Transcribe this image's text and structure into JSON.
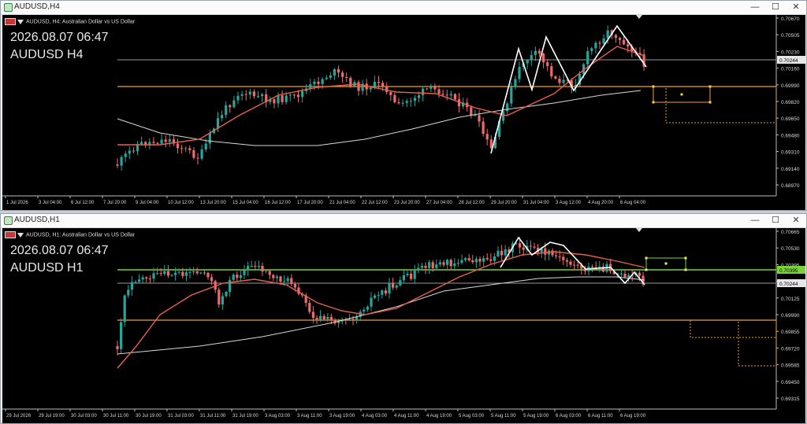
{
  "windows": [
    {
      "title": "AUDUSD,H4",
      "symbol_label": "AUDUSD, H4:  Australian Dollar vs US Dollar",
      "overlay_date": "2026.08.07 06:47",
      "overlay_symbol": "AUDUSD H4",
      "price_ticks": [
        "0.70670",
        "0.70505",
        "0.70230",
        "0.70160",
        "0.69990",
        "0.69820",
        "0.69650",
        "0.69480",
        "0.69310",
        "0.69140",
        "0.68970"
      ],
      "current_price": "0.70244",
      "time_ticks": [
        "1 Jul 2026",
        "3 Jul 04:00",
        "6 Jul 12:00",
        "7 Jul 20:00",
        "9 Jul 04:00",
        "10 Jul 12:00",
        "13 Jul 20:00",
        "15 Jul 04:00",
        "16 Jul 12:00",
        "17 Jul 20:00",
        "21 Jul 04:00",
        "22 Jul 12:00",
        "23 Jul 20:00",
        "27 Jul 04:00",
        "28 Jul 12:00",
        "29 Jul 20:00",
        "31 Jul 04:00",
        "3 Aug 12:00",
        "4 Aug 20:00",
        "6 Aug 04:00"
      ]
    },
    {
      "title": "AUDUSD,H1",
      "symbol_label": "AUDUSD, H1:  Australian Dollar vs US Dollar",
      "overlay_date": "2026.08.07 06:47",
      "overlay_symbol": "AUDUSD H1",
      "price_ticks": [
        "0.70665",
        "0.70530",
        "0.70395",
        "0.70260",
        "0.70125",
        "0.69990",
        "0.69855",
        "0.69720",
        "0.69585",
        "0.69450",
        "0.69315"
      ],
      "current_price": "0.70244",
      "green_price": "0.70395",
      "time_ticks": [
        "29 Jul 2026",
        "29 Jul 19:00",
        "30 Jul 03:00",
        "30 Jul 11:00",
        "30 Jul 19:00",
        "31 Jul 03:00",
        "31 Jul 11:00",
        "31 Jul 19:00",
        "3 Aug 03:00",
        "3 Aug 11:00",
        "3 Aug 19:00",
        "4 Aug 03:00",
        "4 Aug 11:00",
        "4 Aug 19:00",
        "5 Aug 03:00",
        "5 Aug 11:00",
        "5 Aug 19:00",
        "6 Aug 03:00",
        "6 Aug 11:00",
        "6 Aug 19:00"
      ]
    }
  ],
  "window_buttons": {
    "minimize": "—",
    "maximize": "☐",
    "close": "✕"
  },
  "colors": {
    "bull": "#26a69a",
    "bear": "#ef6b6b",
    "ma_fast": "#e8604a",
    "ma_slow": "#d8d8d8",
    "orange_line": "#f0a030",
    "green_line": "#7ad33a",
    "zigzag": "#ffffff"
  }
}
